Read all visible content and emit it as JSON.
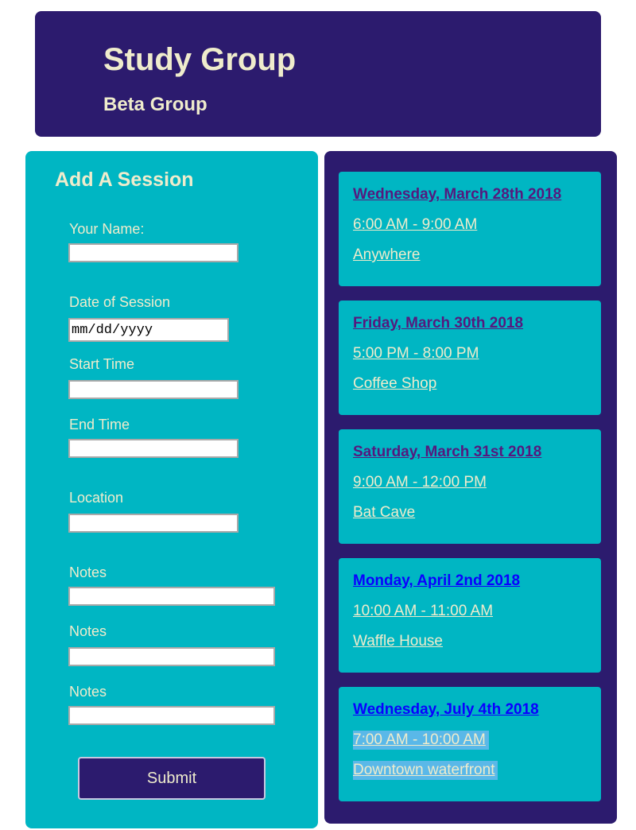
{
  "header": {
    "title": "Study Group",
    "subtitle": "Beta Group"
  },
  "form": {
    "heading": "Add A Session",
    "name_label": "Your Name:",
    "date_label": "Date of Session",
    "date_placeholder": "mm/dd/yyyy",
    "start_label": "Start Time",
    "end_label": "End Time",
    "location_label": "Location",
    "notes_labels": [
      "Notes",
      "Notes",
      "Notes"
    ],
    "submit_label": "Submit"
  },
  "sessions": [
    {
      "date": "Wednesday, March 28th 2018",
      "time": "6:00 AM - 9:00 AM",
      "location": "Anywhere"
    },
    {
      "date": "Friday, March 30th 2018",
      "time": "5:00 PM - 8:00 PM",
      "location": "Coffee Shop"
    },
    {
      "date": "Saturday, March 31st 2018",
      "time": "9:00 AM - 12:00 PM",
      "location": "Bat Cave"
    },
    {
      "date": "Monday, April 2nd 2018",
      "time": "10:00 AM - 11:00 AM",
      "location": "Waffle House"
    },
    {
      "date": "Wednesday, July 4th 2018",
      "time": "7:00 AM - 10:00 AM",
      "location": "Downtown waterfront"
    }
  ],
  "colors": {
    "brand_dark": "#2c1b6e",
    "accent_teal": "#00b6c3",
    "text_cream": "#efeccc",
    "link_visited": "#55197e",
    "link_unvisited": "#0a00ff",
    "selection": "#5ab8e8"
  }
}
